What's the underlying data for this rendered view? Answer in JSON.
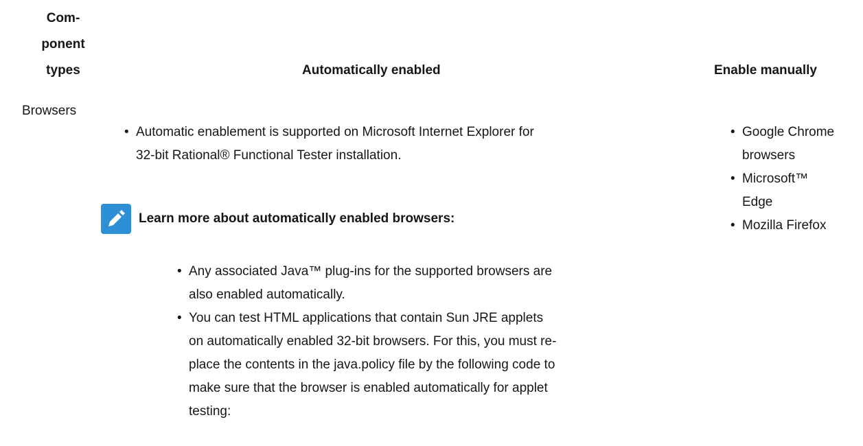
{
  "table": {
    "headers": {
      "component_line1": "Com-",
      "component_line2": "ponent",
      "component_line3": "types",
      "automatic": "Automatically enabled",
      "manual": "Enable manually"
    },
    "row": {
      "component": "Browsers",
      "automatic_items": [
        {
          "line1": "Automatic enablement is supported on Microsoft Internet Explorer for",
          "line2": "32-bit Rational® Functional Tester installation."
        }
      ],
      "note": {
        "icon": "pencil-icon",
        "icon_color": "#2d8fd5",
        "title": "Learn more about automatically enabled browsers:",
        "items": [
          {
            "line1": "Any associated Java™ plug-ins for the supported browsers are",
            "line2": "also enabled automatically."
          },
          {
            "line1": "You can test HTML applications that contain Sun JRE applets",
            "line2": "on automatically enabled 32-bit browsers. For this, you must re-",
            "line3": "place the contents in the java.policy file by the following code to",
            "line4": "make sure that the browser is enabled automatically for applet",
            "line5": "testing:"
          }
        ]
      },
      "manual_items": [
        {
          "line1": "Google Chrome",
          "line2": "browsers"
        },
        {
          "line1": "Microsoft™",
          "line2": "Edge"
        },
        {
          "line1": "Mozilla Firefox"
        }
      ]
    }
  }
}
